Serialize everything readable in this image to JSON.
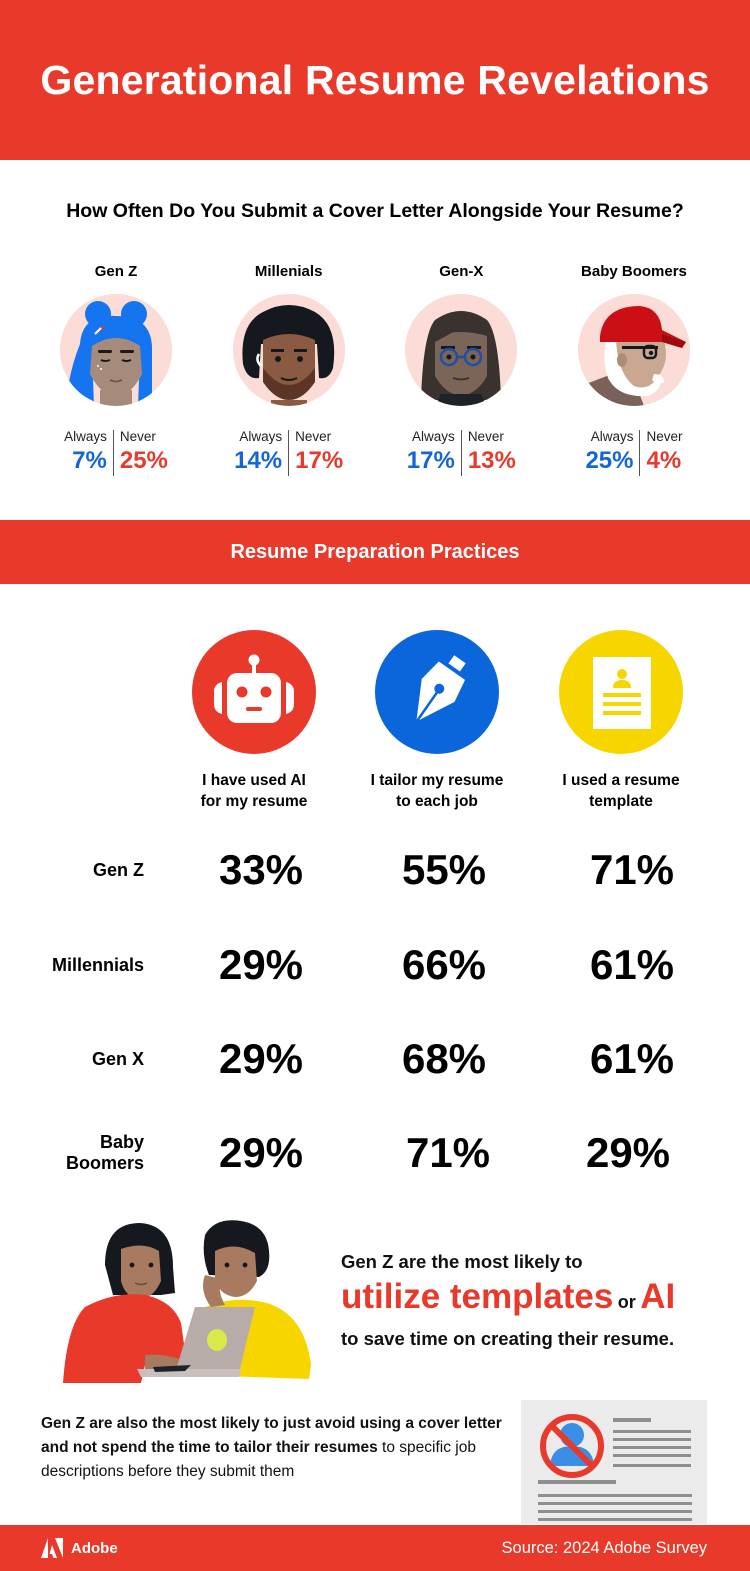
{
  "header": {
    "title": "Generational Resume Revelations"
  },
  "cover_letter": {
    "question": "How Often Do You Submit a Cover Letter Alongside Your Resume?",
    "always_label": "Always",
    "never_label": "Never",
    "generations": [
      {
        "name": "Gen Z",
        "always": "7%",
        "never": "25%",
        "avatar": "gen-z-avatar"
      },
      {
        "name": "Millenials",
        "always": "14%",
        "never": "17%",
        "avatar": "millennial-avatar"
      },
      {
        "name": "Gen-X",
        "always": "17%",
        "never": "13%",
        "avatar": "gen-x-avatar"
      },
      {
        "name": "Baby Boomers",
        "always": "25%",
        "never": "4%",
        "avatar": "boomer-avatar"
      }
    ]
  },
  "practices": {
    "title": "Resume Preparation Practices",
    "columns": [
      {
        "label_line1": "I have used AI",
        "label_line2": "for my resume",
        "icon": "robot-icon",
        "color": "#e8392b"
      },
      {
        "label_line1": "I tailor my resume",
        "label_line2": "to each job",
        "icon": "pen-nib-icon",
        "color": "#0b66db"
      },
      {
        "label_line1": "I used a resume",
        "label_line2": "template",
        "icon": "resume-template-icon",
        "color": "#f7d600"
      }
    ],
    "rows": [
      {
        "label_line1": "Gen Z",
        "label_line2": "",
        "values": [
          "33%",
          "55%",
          "71%"
        ]
      },
      {
        "label_line1": "Millennials",
        "label_line2": "",
        "values": [
          "29%",
          "66%",
          "61%"
        ]
      },
      {
        "label_line1": "Gen X",
        "label_line2": "",
        "values": [
          "29%",
          "68%",
          "61%"
        ]
      },
      {
        "label_line1": "Baby",
        "label_line2": "Boomers",
        "values": [
          "29%",
          "71%",
          "29%"
        ]
      }
    ]
  },
  "callout": {
    "line1": "Gen Z are the most likely to",
    "highlight1": "utilize templates",
    "connector": "or",
    "highlight2": "AI",
    "line3": "to save time on creating their resume."
  },
  "bottom_note": {
    "bold": "Gen Z are also the most likely to just avoid using a cover letter and not spend the time to tailor their resumes",
    "regular": " to specific job descriptions before they submit them"
  },
  "footer": {
    "brand": "Adobe",
    "source": "Source: 2024 Adobe Survey"
  },
  "colors": {
    "brand_red": "#e8392b",
    "always_blue": "#1366d6",
    "icon_blue": "#0b66db",
    "icon_yellow": "#f7d600",
    "avatar_bg": "#fcdcd6"
  },
  "chart_data": [
    {
      "type": "table",
      "title": "How Often Do You Submit a Cover Letter Alongside Your Resume?",
      "categories": [
        "Gen Z",
        "Millenials",
        "Gen-X",
        "Baby Boomers"
      ],
      "series": [
        {
          "name": "Always",
          "values": [
            7,
            14,
            17,
            25
          ]
        },
        {
          "name": "Never",
          "values": [
            25,
            17,
            13,
            4
          ]
        }
      ],
      "unit": "%"
    },
    {
      "type": "table",
      "title": "Resume Preparation Practices",
      "categories": [
        "Gen Z",
        "Millennials",
        "Gen X",
        "Baby Boomers"
      ],
      "series": [
        {
          "name": "I have used AI for my resume",
          "values": [
            33,
            29,
            29,
            29
          ]
        },
        {
          "name": "I tailor my resume to each job",
          "values": [
            55,
            66,
            68,
            71
          ]
        },
        {
          "name": "I used a resume template",
          "values": [
            71,
            61,
            61,
            29
          ]
        }
      ],
      "unit": "%"
    }
  ]
}
